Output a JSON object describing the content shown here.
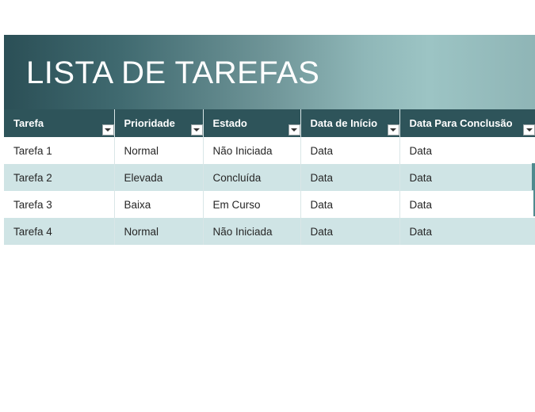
{
  "banner": {
    "title": "LISTA DE TAREFAS"
  },
  "table": {
    "columns": [
      {
        "label": "Tarefa"
      },
      {
        "label": "Prioridade"
      },
      {
        "label": "Estado"
      },
      {
        "label": "Data de Início"
      },
      {
        "label": "Data Para Conclusão"
      }
    ],
    "rows": [
      [
        "Tarefa 1",
        "Normal",
        "Não Iniciada",
        "Data",
        "Data"
      ],
      [
        "Tarefa 2",
        "Elevada",
        "Concluída",
        "Data",
        "Data"
      ],
      [
        "Tarefa 3",
        "Baixa",
        "Em Curso",
        "Data",
        "Data"
      ],
      [
        "Tarefa 4",
        "Normal",
        "Não Iniciada",
        "Data",
        "Data"
      ]
    ]
  },
  "colors": {
    "header_bg": "#2e545a",
    "banner_dark": "#2b4f56",
    "banner_light": "#9cc4c4",
    "row_band": "#cfe4e5",
    "accent_edge": "#4f8a8e"
  },
  "icons": {
    "filter": "filter-dropdown-icon"
  }
}
